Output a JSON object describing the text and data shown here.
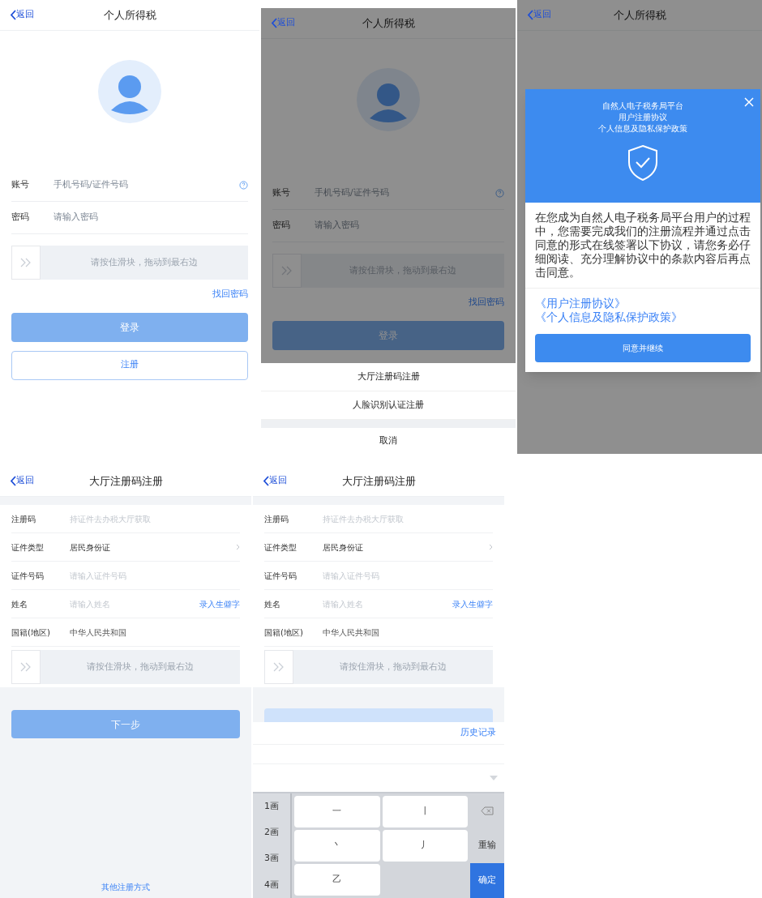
{
  "screens": [
    {
      "kind": "login",
      "dimmed": false,
      "nav": {
        "back": "返回",
        "title": "个人所得税"
      },
      "fields": [
        {
          "label": "账号",
          "placeholder": "手机号码/证件号码",
          "help": true
        },
        {
          "label": "密码",
          "placeholder": "请输入密码",
          "help": false
        }
      ],
      "slider": {
        "text": "请按住滑块，拖动到最右边"
      },
      "forgot": "找回密码",
      "login": {
        "label": "登录",
        "disabled": true
      },
      "register": "注册"
    },
    {
      "kind": "login",
      "dimmed": true,
      "nav": {
        "back": "返回",
        "title": "个人所得税"
      },
      "fields": [
        {
          "label": "账号",
          "placeholder": "手机号码/证件号码",
          "help": true
        },
        {
          "label": "密码",
          "placeholder": "请输入密码",
          "help": false
        }
      ],
      "slider": {
        "text": "请按住滑块，拖动到最右边"
      },
      "forgot": "找回密码",
      "login": {
        "label": "登录",
        "disabled": true
      },
      "sheet": {
        "options": [
          "大厅注册码注册",
          "人脸识别认证注册"
        ],
        "cancel": "取消"
      }
    },
    {
      "kind": "agreement",
      "dimmed": true,
      "nav": {
        "back": "返回",
        "title": "个人所得税"
      },
      "modal": {
        "titles": [
          "自然人电子税务局平台",
          "用户注册协议",
          "个人信息及隐私保护政策"
        ],
        "body": "在您成为自然人电子税务局平台用户的过程中，您需要完成我们的注册流程并通过点击同意的形式在线签署以下协议，请您务必仔细阅读、充分理解协议中的条款内容后再点击同意。",
        "links": [
          "《用户注册协议》",
          "《个人信息及隐私保护政策》"
        ],
        "button": "同意并继续"
      }
    },
    {
      "kind": "register",
      "nav": {
        "back": "返回",
        "title": "大厅注册码注册"
      },
      "rows": [
        {
          "kind": "input",
          "label": "注册码",
          "placeholder": "持证件去办税大厅获取"
        },
        {
          "kind": "select",
          "label": "证件类型",
          "value": "居民身份证"
        },
        {
          "kind": "input",
          "label": "证件号码",
          "placeholder": "请输入证件号码"
        },
        {
          "kind": "input",
          "label": "姓名",
          "placeholder": "请输入姓名",
          "action": "录入生僻字"
        },
        {
          "kind": "static",
          "label": "国籍(地区)",
          "value": "中华人民共和国"
        }
      ],
      "slider": {
        "text": "请按住滑块，拖动到最右边"
      },
      "next": {
        "label": "下一步",
        "disabled": true
      },
      "other": "其他注册方式"
    },
    {
      "kind": "register",
      "nav": {
        "back": "返回",
        "title": "大厅注册码注册"
      },
      "rows": [
        {
          "kind": "input",
          "label": "注册码",
          "placeholder": "持证件去办税大厅获取"
        },
        {
          "kind": "select",
          "label": "证件类型",
          "value": "居民身份证"
        },
        {
          "kind": "input",
          "label": "证件号码",
          "placeholder": "请输入证件号码"
        },
        {
          "kind": "input",
          "label": "姓名",
          "placeholder": "请输入姓名",
          "action": "录入生僻字"
        },
        {
          "kind": "static",
          "label": "国籍(地区)",
          "value": "中华人民共和国"
        }
      ],
      "slider": {
        "text": "请按住滑块，拖动到最右边"
      },
      "next": {
        "disabled": true
      },
      "keyboard": {
        "history": "历史记录",
        "strokes": [
          "1画",
          "2画",
          "3画",
          "4画"
        ],
        "keys": [
          "一",
          "丨",
          "丶",
          "丿",
          "乙"
        ],
        "reset": "重输",
        "confirm": "确定"
      }
    }
  ]
}
